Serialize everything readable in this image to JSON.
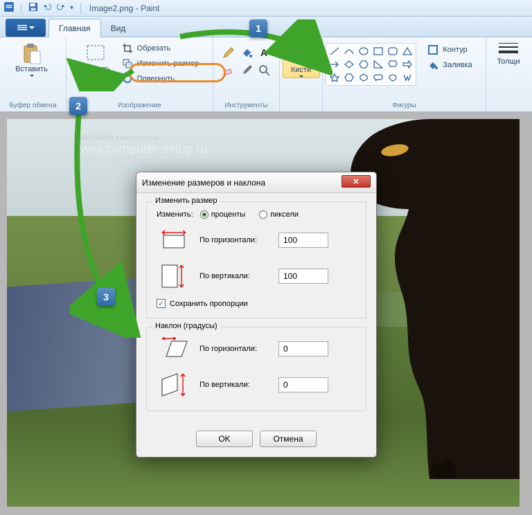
{
  "window": {
    "title": "Image2.png - Paint"
  },
  "tabs": {
    "main": "Главная",
    "view": "Вид"
  },
  "ribbon": {
    "clipboard": {
      "paste": "Вставить",
      "label": "Буфер обмена"
    },
    "image": {
      "select": "ыделить",
      "crop": "Обрезать",
      "resize": "Изменить размер",
      "rotate": "Повернуть",
      "label": "Изображение"
    },
    "tools": {
      "label": "Инструменты"
    },
    "brushes": {
      "btn": "Кисти"
    },
    "shapes": {
      "label": "Фигуры",
      "outline": "Контур",
      "fill": "Заливка"
    },
    "thickness": {
      "btn": "Толщи"
    }
  },
  "watermark": {
    "line1": "Настройка компьютера",
    "line2": "www.computer-setup.ru"
  },
  "dialog": {
    "title": "Изменение размеров и наклона",
    "resize_legend": "Изменить размер",
    "change_label": "Изменить:",
    "percent": "проценты",
    "pixels": "пиксели",
    "horiz": "По горизонтали:",
    "vert": "По вертикали:",
    "h_val": "100",
    "v_val": "100",
    "keep_aspect": "Сохранить пропорции",
    "skew_legend": "Наклон (градусы)",
    "skew_h": "0",
    "skew_v": "0",
    "ok": "OK",
    "cancel": "Отмена"
  },
  "annotations": {
    "b1": "1",
    "b2": "2",
    "b3": "3"
  }
}
